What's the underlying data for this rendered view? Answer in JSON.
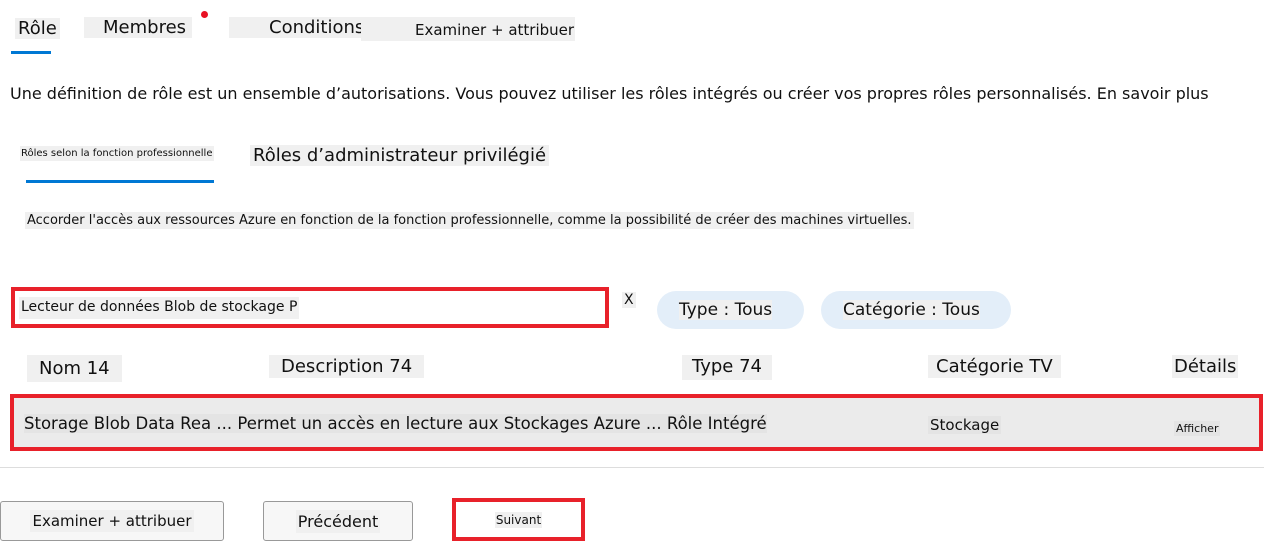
{
  "tabs": [
    {
      "label": "Rôle",
      "active": true
    },
    {
      "label": "Membres",
      "has_dot": true
    },
    {
      "label": "Conditions"
    },
    {
      "label": "Examiner + attribuer"
    }
  ],
  "intro": "Une définition de rôle est un ensemble d’autorisations. Vous pouvez utiliser les rôles intégrés ou créer vos propres rôles personnalisés. En savoir plus",
  "subtabs": [
    {
      "label": "Rôles selon la fonction professionnelle",
      "active": true
    },
    {
      "label": "Rôles d’administrateur privilégié"
    }
  ],
  "subtab_description": "Accorder l'accès aux ressources Azure en fonction de la fonction professionnelle, comme la possibilité de créer des machines virtuelles.",
  "search": {
    "value": "Lecteur de données Blob de stockage P",
    "clear": "X"
  },
  "filters": {
    "type": "Type : Tous",
    "category": "Catégorie : Tous"
  },
  "table": {
    "headers": [
      "Nom 14",
      "Description 74",
      "Type 74",
      "Catégorie TV",
      "Détails"
    ],
    "rows": [
      {
        "name_desc_type": "Storage Blob Data Rea ... Permet un accès en lecture aux Stockages Azure ... Rôle Intégré",
        "category": "Stockage",
        "details": "Afficher"
      }
    ]
  },
  "buttons": {
    "review": "Examiner + attribuer",
    "previous": "Précédent",
    "next": "Suivant"
  },
  "colors": {
    "accent": "#0078d4",
    "highlight": "#e8212a",
    "dot": "#e81123"
  }
}
